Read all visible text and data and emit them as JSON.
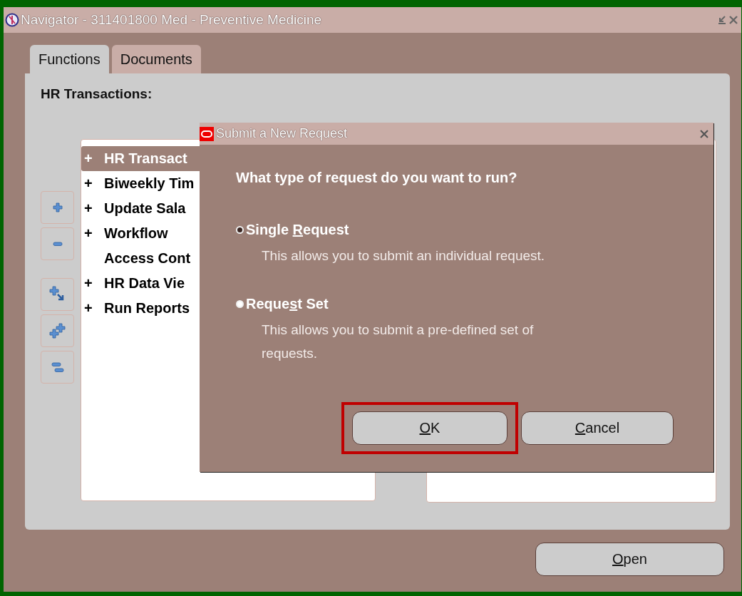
{
  "window": {
    "title": "Navigator - 311401800 Med - Preventive Medicine"
  },
  "tabs": [
    {
      "label": "Functions",
      "selected": true
    },
    {
      "label": "Documents",
      "selected": false
    }
  ],
  "heading": "HR Transactions:",
  "tree": [
    {
      "marker": "+",
      "label": "HR Transact",
      "selected": true
    },
    {
      "marker": "+",
      "label": "Biweekly Tim",
      "selected": false
    },
    {
      "marker": "+",
      "label": "Update Sala",
      "selected": false
    },
    {
      "marker": "+",
      "label": "Workflow",
      "selected": false
    },
    {
      "label": "Access Cont",
      "selected": false
    },
    {
      "marker": "+",
      "label": "HR Data Vie",
      "selected": false
    },
    {
      "marker": "+",
      "label": "Run Reports",
      "selected": false
    }
  ],
  "side_buttons": [
    {
      "kind": "expand"
    },
    {
      "kind": "collapse"
    },
    {
      "kind": "expand-branch"
    },
    {
      "kind": "expand-all"
    },
    {
      "kind": "collapse-all"
    }
  ],
  "open_button": {
    "key": "O",
    "post": "pen"
  },
  "dialog": {
    "title": "Submit a New Request",
    "question": "What type of request do you want to run?",
    "options": [
      {
        "pre": "Single ",
        "key": "R",
        "post": "equest",
        "description": "This allows you to submit an individual request.",
        "selected": true
      },
      {
        "pre": "Reque",
        "key": "s",
        "post": "t Set",
        "description": "This allows you to submit a pre-defined set of requests.",
        "selected": false
      }
    ],
    "buttons": [
      {
        "key": "O",
        "post": "K",
        "highlighted": true
      },
      {
        "key": "C",
        "post": "ancel",
        "highlighted": false
      }
    ]
  }
}
